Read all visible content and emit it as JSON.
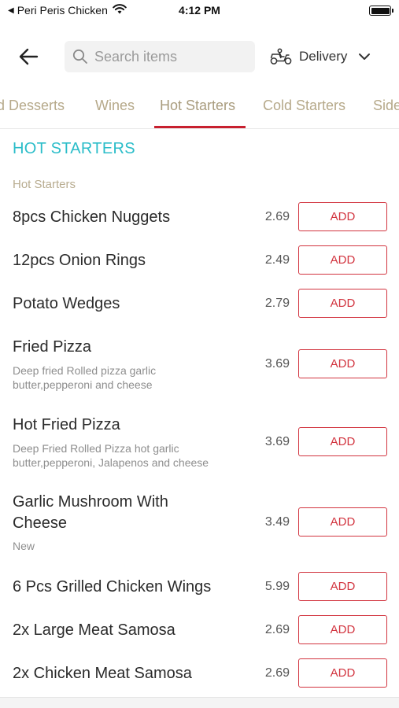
{
  "status_bar": {
    "back_app": "Peri Peris Chicken",
    "time": "4:12 PM"
  },
  "header": {
    "back_icon": "arrow-left-icon",
    "search_placeholder": "Search items",
    "search_value": "",
    "delivery_label": "Delivery"
  },
  "tabs": [
    {
      "label": "d Desserts",
      "active": false
    },
    {
      "label": "Wines",
      "active": false
    },
    {
      "label": "Hot Starters",
      "active": true
    },
    {
      "label": "Cold Starters",
      "active": false
    },
    {
      "label": "Side",
      "active": false
    }
  ],
  "section": {
    "title": "HOT STARTERS",
    "subcategory": "Hot Starters"
  },
  "add_label": "ADD",
  "items": [
    {
      "name": "8pcs Chicken Nuggets",
      "price": "2.69"
    },
    {
      "name": "12pcs Onion Rings",
      "price": "2.49"
    },
    {
      "name": "Potato Wedges",
      "price": "2.79"
    },
    {
      "name": "Fried Pizza",
      "desc_line1": "Deep fried Rolled pizza garlic",
      "desc_line2": "butter,pepperoni and cheese",
      "price": "3.69"
    },
    {
      "name": "Hot Fried Pizza",
      "desc_line1": "Deep Fried Rolled Pizza hot garlic",
      "desc_line2": "butter,pepperoni, Jalapenos and cheese",
      "price": "3.69"
    },
    {
      "name_line1": "Garlic Mushroom With",
      "name_line2": "Cheese",
      "tag": "New",
      "price": "3.49"
    },
    {
      "name": "6 Pcs Grilled Chicken Wings",
      "price": "5.99"
    },
    {
      "name": "2x Large Meat Samosa",
      "price": "2.69"
    },
    {
      "name": "2x Chicken Meat Samosa",
      "price": "2.69"
    }
  ],
  "colors": {
    "accent_red": "#d2343f",
    "section_teal": "#2bbdc9",
    "tab_text": "#b6a98a"
  }
}
